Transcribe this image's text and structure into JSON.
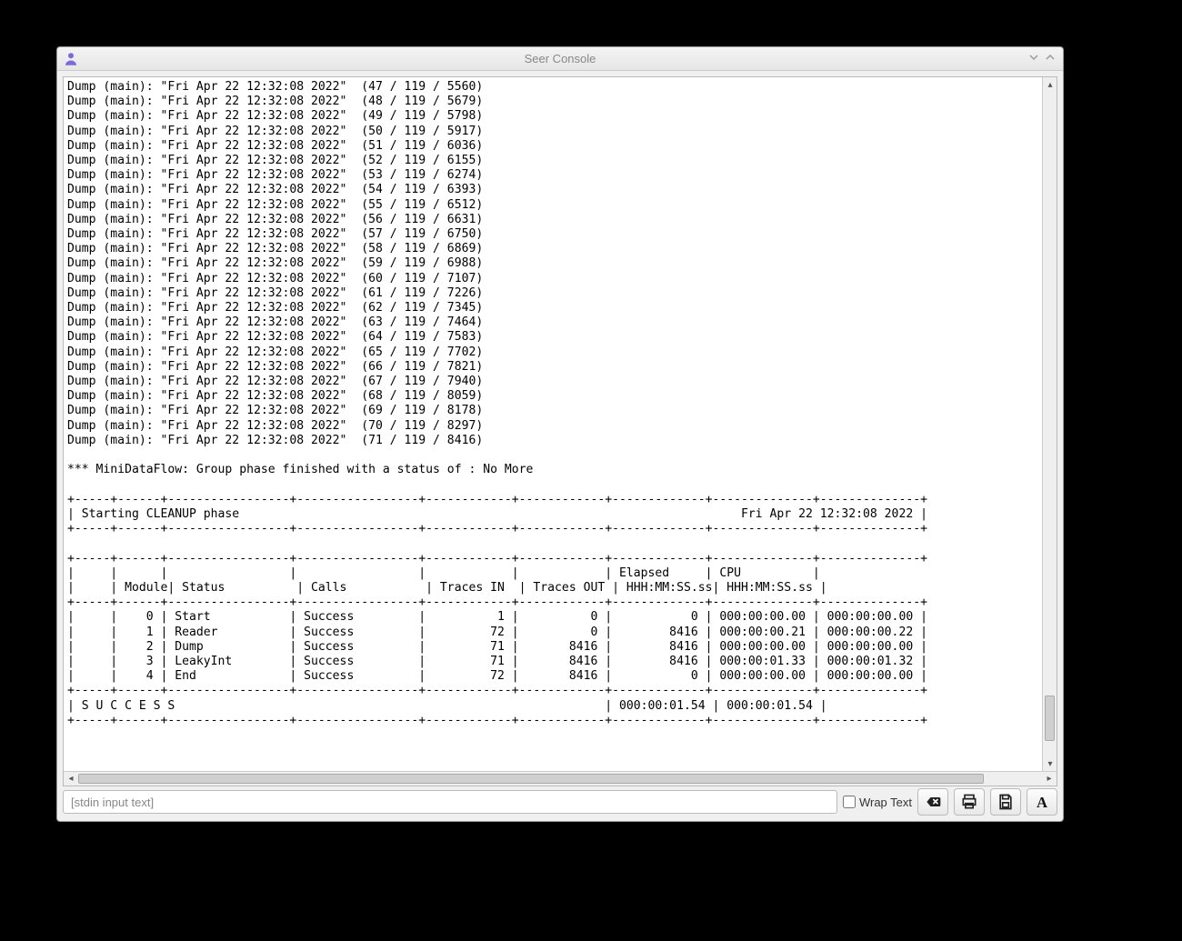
{
  "window": {
    "title": "Seer Console"
  },
  "console": {
    "dump_prefix": "Dump (main): \"Fri Apr 22 12:32:08 2022\"",
    "dump_lines": [
      {
        "a": 47,
        "b": 119,
        "c": 5560
      },
      {
        "a": 48,
        "b": 119,
        "c": 5679
      },
      {
        "a": 49,
        "b": 119,
        "c": 5798
      },
      {
        "a": 50,
        "b": 119,
        "c": 5917
      },
      {
        "a": 51,
        "b": 119,
        "c": 6036
      },
      {
        "a": 52,
        "b": 119,
        "c": 6155
      },
      {
        "a": 53,
        "b": 119,
        "c": 6274
      },
      {
        "a": 54,
        "b": 119,
        "c": 6393
      },
      {
        "a": 55,
        "b": 119,
        "c": 6512
      },
      {
        "a": 56,
        "b": 119,
        "c": 6631
      },
      {
        "a": 57,
        "b": 119,
        "c": 6750
      },
      {
        "a": 58,
        "b": 119,
        "c": 6869
      },
      {
        "a": 59,
        "b": 119,
        "c": 6988
      },
      {
        "a": 60,
        "b": 119,
        "c": 7107
      },
      {
        "a": 61,
        "b": 119,
        "c": 7226
      },
      {
        "a": 62,
        "b": 119,
        "c": 7345
      },
      {
        "a": 63,
        "b": 119,
        "c": 7464
      },
      {
        "a": 64,
        "b": 119,
        "c": 7583
      },
      {
        "a": 65,
        "b": 119,
        "c": 7702
      },
      {
        "a": 66,
        "b": 119,
        "c": 7821
      },
      {
        "a": 67,
        "b": 119,
        "c": 7940
      },
      {
        "a": 68,
        "b": 119,
        "c": 8059
      },
      {
        "a": 69,
        "b": 119,
        "c": 8178
      },
      {
        "a": 70,
        "b": 119,
        "c": 8297
      },
      {
        "a": 71,
        "b": 119,
        "c": 8416
      }
    ],
    "status_line": "*** MiniDataFlow: Group phase finished with a status of : No More",
    "phase_header_left": " Starting CLEANUP phase",
    "phase_header_right": "Fri Apr 22 12:32:08 2022 ",
    "table_headers_row1": [
      "",
      "",
      "",
      "",
      "",
      "",
      "Elapsed",
      "CPU"
    ],
    "table_headers_row2": [
      "",
      "Module",
      "Status",
      "Calls",
      "Traces IN",
      "Traces OUT",
      "HHH:MM:SS.ss",
      "HHH:MM:SS.ss"
    ],
    "table_rows": [
      {
        "idx": "0",
        "module": "Start",
        "status": "Success",
        "calls": "1",
        "traces_in": "0",
        "traces_out": "0",
        "elapsed": "000:00:00.00",
        "cpu": "000:00:00.00"
      },
      {
        "idx": "1",
        "module": "Reader",
        "status": "Success",
        "calls": "72",
        "traces_in": "0",
        "traces_out": "8416",
        "elapsed": "000:00:00.21",
        "cpu": "000:00:00.22"
      },
      {
        "idx": "2",
        "module": "Dump",
        "status": "Success",
        "calls": "71",
        "traces_in": "8416",
        "traces_out": "8416",
        "elapsed": "000:00:00.00",
        "cpu": "000:00:00.00"
      },
      {
        "idx": "3",
        "module": "LeakyInt",
        "status": "Success",
        "calls": "71",
        "traces_in": "8416",
        "traces_out": "8416",
        "elapsed": "000:00:01.33",
        "cpu": "000:00:01.32"
      },
      {
        "idx": "4",
        "module": "End",
        "status": "Success",
        "calls": "72",
        "traces_in": "8416",
        "traces_out": "0",
        "elapsed": "000:00:00.00",
        "cpu": "000:00:00.00"
      }
    ],
    "summary_label": " S U C C E S S",
    "summary_elapsed": "000:00:01.54",
    "summary_cpu": "000:00:01.54"
  },
  "bottombar": {
    "stdin_placeholder": "[stdin input text]",
    "wrap_label": "Wrap Text",
    "wrap_checked": false
  }
}
